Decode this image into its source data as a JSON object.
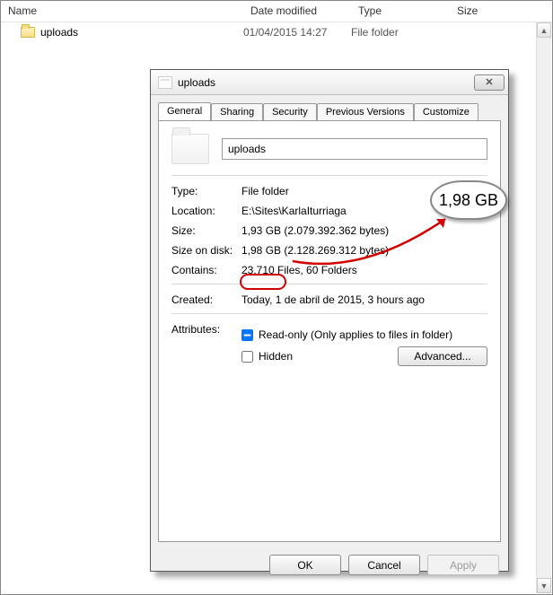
{
  "explorer": {
    "columns": {
      "name": "Name",
      "date": "Date modified",
      "type": "Type",
      "size": "Size"
    },
    "rows": [
      {
        "name": "uploads",
        "date": "01/04/2015 14:27",
        "type": "File folder"
      }
    ]
  },
  "dialog": {
    "title": "uploads",
    "tabs": [
      "General",
      "Sharing",
      "Security",
      "Previous Versions",
      "Customize"
    ],
    "name_value": "uploads",
    "type_label": "Type:",
    "type_value": "File folder",
    "location_label": "Location:",
    "location_value": "E:\\Sites\\KarlaIturriaga",
    "size_label": "Size:",
    "size_value": "1,93 GB (2.079.392.362 bytes)",
    "sizeondisk_label": "Size on disk:",
    "sizeondisk_value_hl": "1,98 GB",
    "sizeondisk_value_rest": " (2.128.269.312 bytes)",
    "contains_label": "Contains:",
    "contains_value": "23.710 Files, 60 Folders",
    "created_label": "Created:",
    "created_value": "Today, 1 de abril de 2015, 3 hours ago",
    "attr_label": "Attributes:",
    "attr_readonly": "Read-only (Only applies to files in folder)",
    "attr_hidden": "Hidden",
    "advanced": "Advanced...",
    "ok": "OK",
    "cancel": "Cancel",
    "apply": "Apply"
  },
  "annotation": {
    "big_label": "1,98 GB"
  }
}
